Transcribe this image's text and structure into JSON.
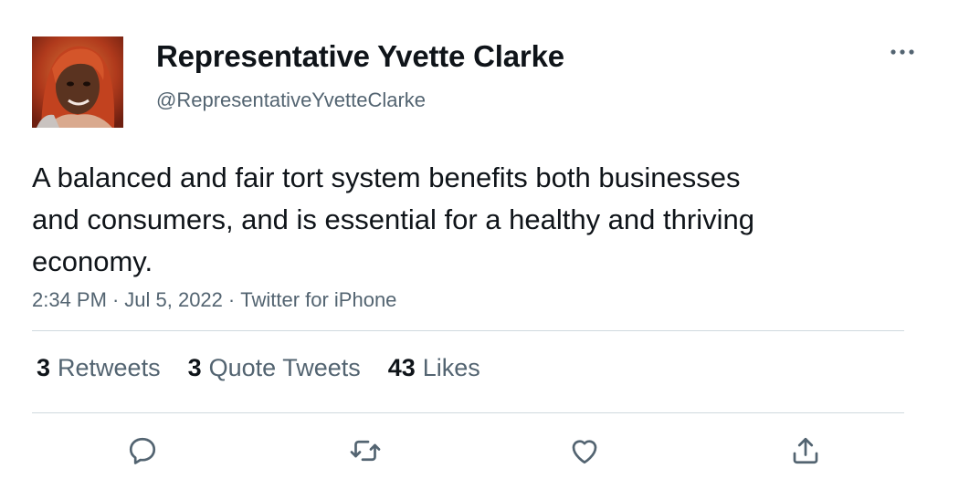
{
  "user": {
    "display_name": "Representative Yvette Clarke",
    "handle": "@RepresentativeYvetteClarke",
    "avatar_icon": "profile-photo"
  },
  "tweet": {
    "text": "A balanced and fair tort system benefits both businesses and consumers, and is essential for a healthy and thriving economy.",
    "time": "2:34 PM",
    "date": "Jul 5, 2022",
    "source": "Twitter for iPhone",
    "separator": "·"
  },
  "stats": {
    "retweets": {
      "count": "3",
      "label": "Retweets"
    },
    "quote_tweets": {
      "count": "3",
      "label": "Quote Tweets"
    },
    "likes": {
      "count": "43",
      "label": "Likes"
    }
  },
  "actions": {
    "reply_icon": "reply-icon",
    "retweet_icon": "retweet-icon",
    "like_icon": "heart-icon",
    "share_icon": "share-icon"
  },
  "colors": {
    "text_primary": "#0f1419",
    "text_secondary": "#536471",
    "divider": "#cfd9de"
  }
}
